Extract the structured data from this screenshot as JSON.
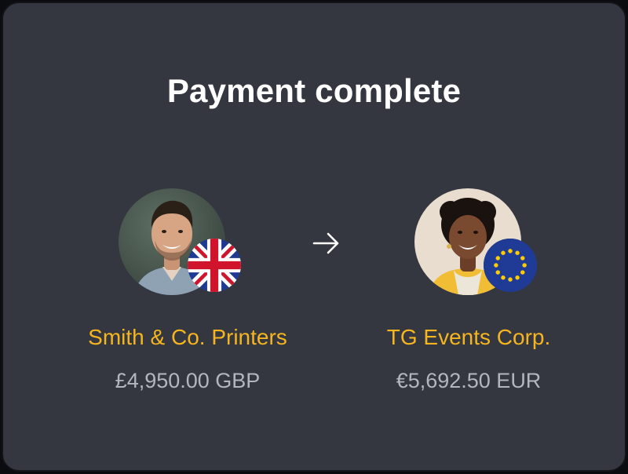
{
  "dialog": {
    "title": "Payment complete"
  },
  "sender": {
    "name": "Smith & Co. Printers",
    "amount": "£4,950.00 GBP",
    "flag_icon": "uk-flag-icon"
  },
  "recipient": {
    "name": "TG Events Corp.",
    "amount": "€5,692.50 EUR",
    "flag_icon": "eu-flag-icon"
  },
  "transfer_icon": "arrow-right-icon",
  "colors": {
    "background": "#353740",
    "title": "#ffffff",
    "name_accent": "#f5b51f",
    "amount": "#b4b6bf"
  }
}
